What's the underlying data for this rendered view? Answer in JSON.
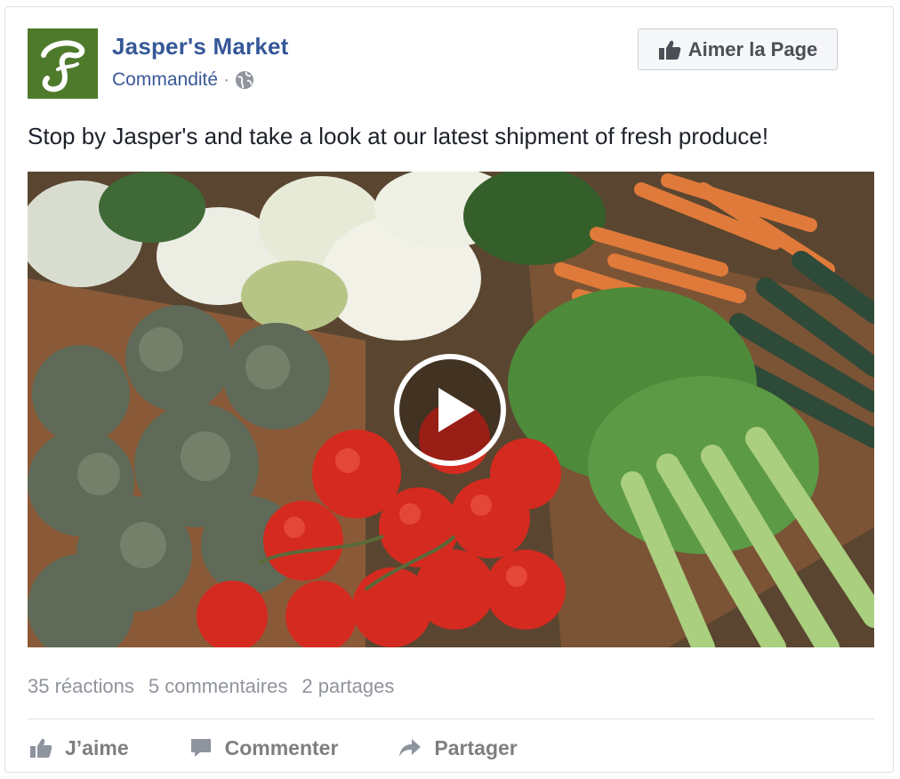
{
  "post": {
    "page_name": "Jasper's Market",
    "sponsored_label": "Commandité",
    "separator": "·",
    "privacy_icon": "globe-icon",
    "like_page_button": "Aimer la Page",
    "text": "Stop by Jasper's and take a look at our latest shipment of fresh produce!",
    "media": {
      "type": "video",
      "description": "vegetable-stand-photo",
      "overlay_icon": "play-icon"
    }
  },
  "stats": {
    "reactions": "35 réactions",
    "comments": "5 commentaires",
    "shares": "2 partages"
  },
  "actions": {
    "like": "J’aime",
    "comment": "Commenter",
    "share": "Partager"
  },
  "colors": {
    "brand_blue": "#365899",
    "meta_blue": "#3b5998",
    "muted_gray": "#90949c",
    "action_gray": "#7f7f7f",
    "logo_green": "#4e7a2b"
  }
}
